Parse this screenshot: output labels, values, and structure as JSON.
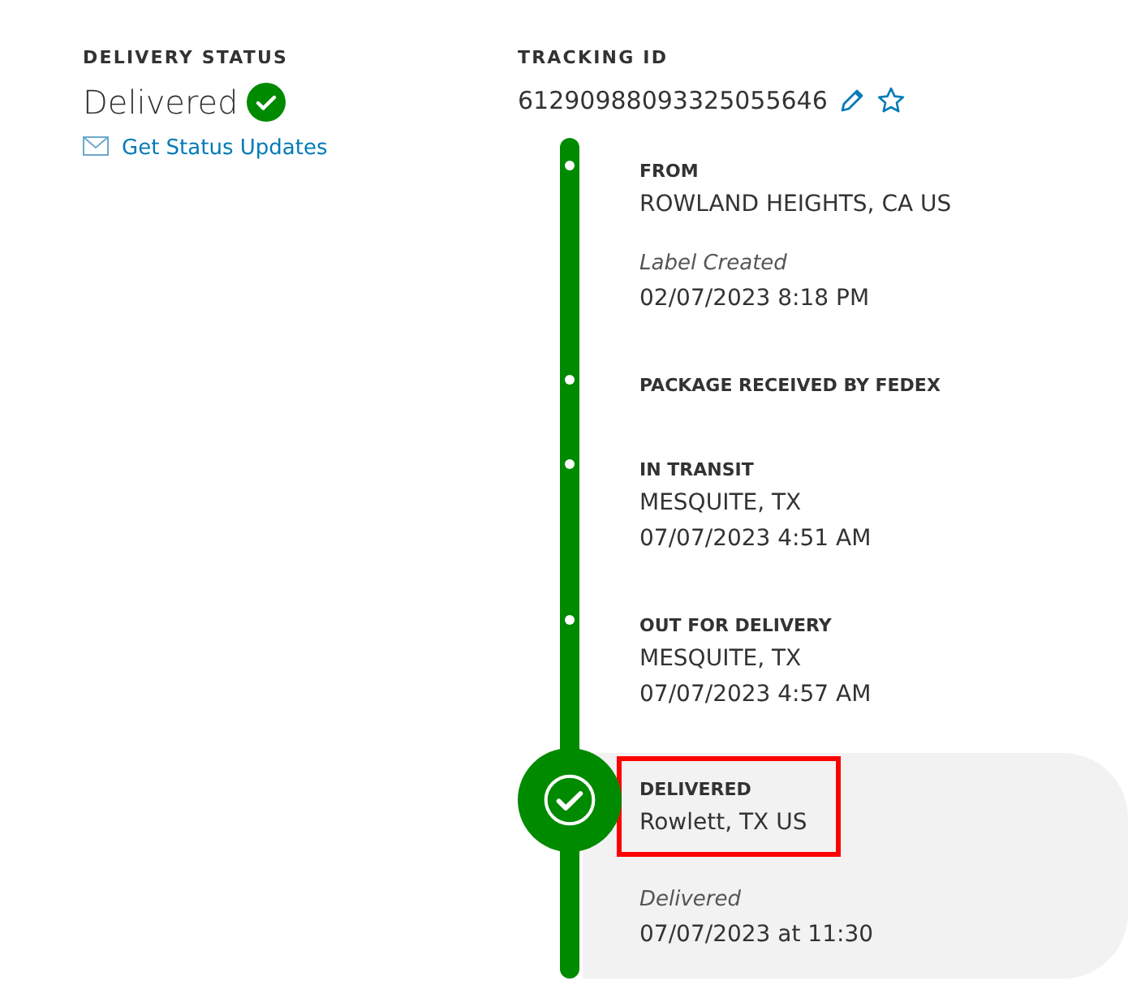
{
  "delivery_status": {
    "label": "DELIVERY STATUS",
    "status": "Delivered",
    "delivered": true,
    "updates_link": "Get Status Updates"
  },
  "tracking": {
    "label": "TRACKING ID",
    "id": "61290988093325055646",
    "starred": false
  },
  "events": [
    {
      "kind": "step",
      "heading": "FROM",
      "location": "ROWLAND HEIGHTS, CA US",
      "note": "Label Created",
      "date": "02/07/2023 8:18 PM",
      "highlighted": false
    },
    {
      "kind": "step",
      "heading": "PACKAGE RECEIVED BY FEDEX",
      "highlighted": false
    },
    {
      "kind": "step",
      "heading": "IN TRANSIT",
      "location": "MESQUITE, TX",
      "date": "07/07/2023 4:51 AM",
      "highlighted": false
    },
    {
      "kind": "step",
      "heading": "OUT FOR DELIVERY",
      "location": "MESQUITE, TX",
      "date": "07/07/2023 4:57 AM",
      "highlighted": false
    },
    {
      "kind": "final",
      "heading": "DELIVERED",
      "location": "Rowlett, TX US",
      "note": "Delivered",
      "date": "07/07/2023 at 11:30",
      "highlighted": true
    }
  ]
}
